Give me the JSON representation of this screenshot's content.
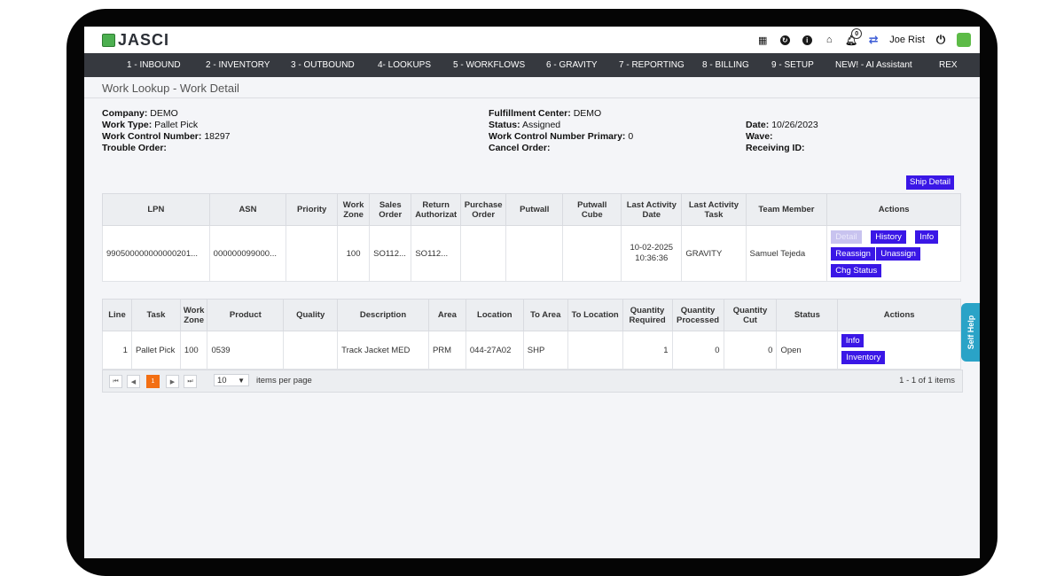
{
  "app": {
    "name": "JASCI",
    "user": "Joe Rist",
    "notification_count": "0"
  },
  "nav": [
    "1 - INBOUND",
    "2 - INVENTORY",
    "3 - OUTBOUND",
    "4- LOOKUPS",
    "5 - WORKFLOWS",
    "6 - GRAVITY",
    "7 - REPORTING",
    "8 - BILLING",
    "9 - SETUP",
    "NEW! - AI Assistant",
    "REX"
  ],
  "page_title": "Work Lookup - Work Detail",
  "info": {
    "company_label": "Company:",
    "company": "DEMO",
    "work_type_label": "Work Type:",
    "work_type": "Pallet Pick",
    "wcn_label": "Work Control Number:",
    "wcn": "18297",
    "trouble_label": "Trouble Order:",
    "fc_label": "Fulfillment Center:",
    "fc": "DEMO",
    "status_label": "Status:",
    "status": "Assigned",
    "wcnp_label": "Work Control Number Primary:",
    "wcnp": "0",
    "cancel_label": "Cancel Order:",
    "date_label": "Date:",
    "date": "10/26/2023",
    "wave_label": "Wave:",
    "receiving_label": "Receiving ID:"
  },
  "ship_detail_label": "Ship Detail",
  "work_table": {
    "headers": [
      "LPN",
      "ASN",
      "Priority",
      "Work Zone",
      "Sales Order",
      "Return Authorizat",
      "Purchase Order",
      "Putwall",
      "Putwall Cube",
      "Last Activity Date",
      "Last Activity Task",
      "Team Member",
      "Actions"
    ],
    "row": {
      "lpn": "990500000000000201...",
      "asn": "000000099000...",
      "priority": "",
      "work_zone": "100",
      "sales_order": "SO112...",
      "return_auth": "SO112...",
      "purchase_order": "",
      "putwall": "",
      "putwall_cube": "",
      "last_activity_date": "10-02-2025",
      "last_activity_time": "10:36:36",
      "last_activity_task": "GRAVITY",
      "team_member": "Samuel Tejeda"
    },
    "actions": {
      "detail": "Detail",
      "history": "History",
      "info": "Info",
      "reassign": "Reassign",
      "unassign": "Unassign",
      "chg_status": "Chg Status"
    }
  },
  "line_table": {
    "headers": [
      "Line",
      "Task",
      "Work Zone",
      "Product",
      "Quality",
      "Description",
      "Area",
      "Location",
      "To Area",
      "To Location",
      "Quantity Required",
      "Quantity Processed",
      "Quantity Cut",
      "Status",
      "Actions"
    ],
    "rows": [
      {
        "line": "1",
        "task": "Pallet Pick",
        "work_zone": "100",
        "product": "0539",
        "quality": "",
        "description": "Track Jacket MED",
        "area": "PRM",
        "location": "044-27A02",
        "to_area": "SHP",
        "to_location": "",
        "qty_required": "1",
        "qty_processed": "0",
        "qty_cut": "0",
        "status": "Open"
      }
    ],
    "actions": {
      "info": "Info",
      "inventory": "Inventory"
    }
  },
  "pager": {
    "current_page": "1",
    "page_size": "10",
    "items_per_page_label": "items per page",
    "summary": "1 - 1 of 1 items"
  },
  "self_help_label": "Self Help"
}
